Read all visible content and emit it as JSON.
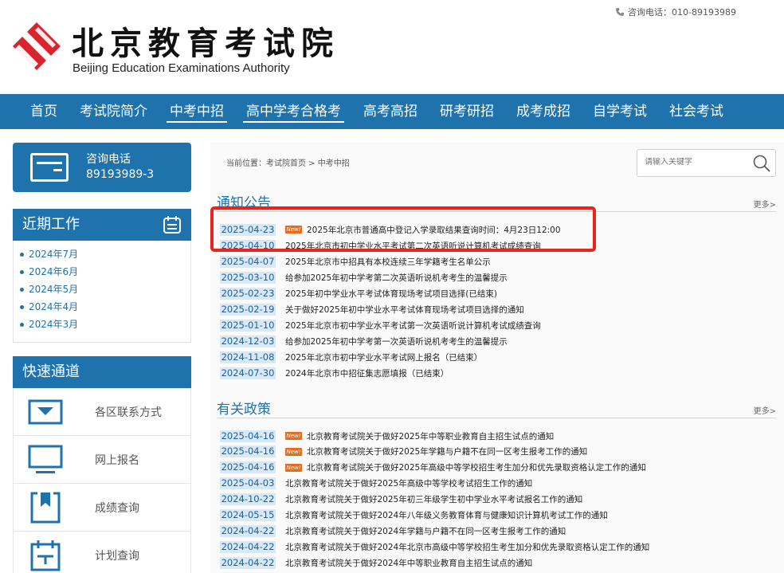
{
  "header": {
    "hotline": "咨询电话：010-89193989",
    "logo_cn": "北京教育考试院",
    "logo_en": "Beijing Education Examinations Authority",
    "brand_color": "#d9232d"
  },
  "nav": {
    "items": [
      "首页",
      "考试院简介",
      "中考中招",
      "高中学考合格考",
      "高考高招",
      "研考研招",
      "成考成招",
      "自学考试",
      "社会考试"
    ],
    "active_index": 2
  },
  "sidebar": {
    "consult": {
      "label": "咨询电话",
      "number": "89193989-3"
    },
    "recent_title": "近期工作",
    "recent_items": [
      "2024年7月",
      "2024年6月",
      "2024年5月",
      "2024年4月",
      "2024年3月"
    ],
    "quick_title": "快速通道",
    "quick_items": [
      {
        "label": "各区联系方式",
        "icon": "envelope-icon"
      },
      {
        "label": "网上报名",
        "icon": "monitor-icon"
      },
      {
        "label": "成绩查询",
        "icon": "bookmark-icon"
      },
      {
        "label": "计划查询",
        "icon": "calendar-icon"
      }
    ]
  },
  "main": {
    "breadcrumb": "当前位置：考试院首页 > 中考中招",
    "search": {
      "placeholder": "请输入关键字"
    },
    "notices": {
      "title": "通知公告",
      "more": "更多>",
      "items": [
        {
          "date": "2025-04-23",
          "new": true,
          "title": "2025年北京市普通高中登记入学录取结果查询时间：4月23日12:00"
        },
        {
          "date": "2025-04-10",
          "new": false,
          "title": "2025年北京市初中学业水平考试第二次英语听说计算机考试成绩查询"
        },
        {
          "date": "2025-04-07",
          "new": false,
          "title": "2025年北京市中招具有本校连续三年学籍考生名单公示"
        },
        {
          "date": "2025-03-10",
          "new": false,
          "title": "给参加2025年初中学考第二次英语听说机考考生的温馨提示"
        },
        {
          "date": "2025-02-23",
          "new": false,
          "title": "2025年初中学业水平考试体育现场考试项目选择(已结束)"
        },
        {
          "date": "2025-02-19",
          "new": false,
          "title": "关于做好2025年初中学业水平考试体育现场考试项目选择的通知"
        },
        {
          "date": "2025-01-10",
          "new": false,
          "title": "2025年北京市初中学业水平考试第一次英语听说计算机考试成绩查询"
        },
        {
          "date": "2024-12-03",
          "new": false,
          "title": "给参加2025年初中学考第一次英语听说机考考生的温馨提示"
        },
        {
          "date": "2024-11-08",
          "new": false,
          "title": "2025年北京市初中学业水平考试网上报名（已结束）"
        },
        {
          "date": "2024-07-30",
          "new": false,
          "title": "2024年北京市中招征集志愿填报（已结束）"
        }
      ]
    },
    "policies": {
      "title": "有关政策",
      "more": "更多>",
      "items": [
        {
          "date": "2025-04-16",
          "new": true,
          "title": "北京教育考试院关于做好2025年中等职业教育自主招生试点的通知"
        },
        {
          "date": "2025-04-16",
          "new": true,
          "title": "北京教育考试院关于做好2025年学籍与户籍不在同一区考生报考工作的通知"
        },
        {
          "date": "2025-04-16",
          "new": true,
          "title": "北京教育考试院关于做好2025年高级中等学校招生考生加分和优先录取资格认定工作的通知"
        },
        {
          "date": "2025-04-03",
          "new": false,
          "title": "北京教育考试院关于做好2025年高级中等学校考试招生工作的通知"
        },
        {
          "date": "2024-10-22",
          "new": false,
          "title": "北京教育考试院关于做好2025年初三年级学生初中学业水平考试报名工作的通知"
        },
        {
          "date": "2024-05-15",
          "new": false,
          "title": "北京教育考试院关于做好2024年八年级义务教育体育与健康知识计算机考试工作的通知"
        },
        {
          "date": "2024-04-22",
          "new": false,
          "title": "北京教育考试院关于做好2024年学籍与户籍不在同一区考生报考工作的通知"
        },
        {
          "date": "2024-04-22",
          "new": false,
          "title": "北京教育考试院关于做好2024年北京市高级中等学校招生考生加分和优先录取资格认定工作的通知"
        },
        {
          "date": "2024-04-22",
          "new": false,
          "title": "北京教育考试院关于做好2024年中等职业教育自主招生试点的通知"
        }
      ]
    },
    "new_tag": "New!",
    "highlight_color": "#e8241f",
    "accent_color": "#1f73ad"
  }
}
